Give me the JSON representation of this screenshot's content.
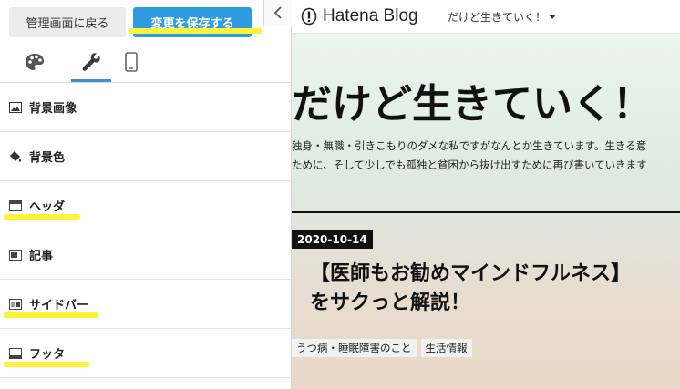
{
  "panel": {
    "back_label": "管理画面に戻る",
    "save_label": "変更を保存する",
    "collapse_icon": "chevron-left-icon",
    "tabs": [
      {
        "icon": "palette-icon",
        "active": false
      },
      {
        "icon": "wrench-icon",
        "active": true
      },
      {
        "icon": "smartphone-icon",
        "active": false
      }
    ],
    "menu": [
      {
        "label": "背景画像",
        "icon": "image-icon"
      },
      {
        "label": "背景色",
        "icon": "paint-bucket-icon"
      },
      {
        "label": "ヘッダ",
        "icon": "layout-header-icon"
      },
      {
        "label": "記事",
        "icon": "layout-article-icon"
      },
      {
        "label": "サイドバー",
        "icon": "layout-sidebar-icon"
      },
      {
        "label": "フッタ",
        "icon": "layout-footer-icon"
      }
    ]
  },
  "preview": {
    "brand": "Hatena Blog",
    "blog_selector": "だけど生きていく！",
    "blog_title": "だけど生きていく！",
    "description_line1": "独身・無職・引きこもりのダメな私ですがなんとか生きています。生きる意",
    "description_line2": "ために、そして少しでも孤独と貧困から抜け出すために再び書いていきます",
    "entry": {
      "date": "2020-10-14",
      "title_line1": "【医師もお勧めマインドフルネス】",
      "title_line2": "をサクっと解説！",
      "tags": [
        "うつ病・睡眠障害のこと",
        "生活情報"
      ]
    }
  },
  "colors": {
    "save_button": "#2f9be0",
    "highlight": "#fff23a",
    "active_tab": "#3d8fd8"
  }
}
